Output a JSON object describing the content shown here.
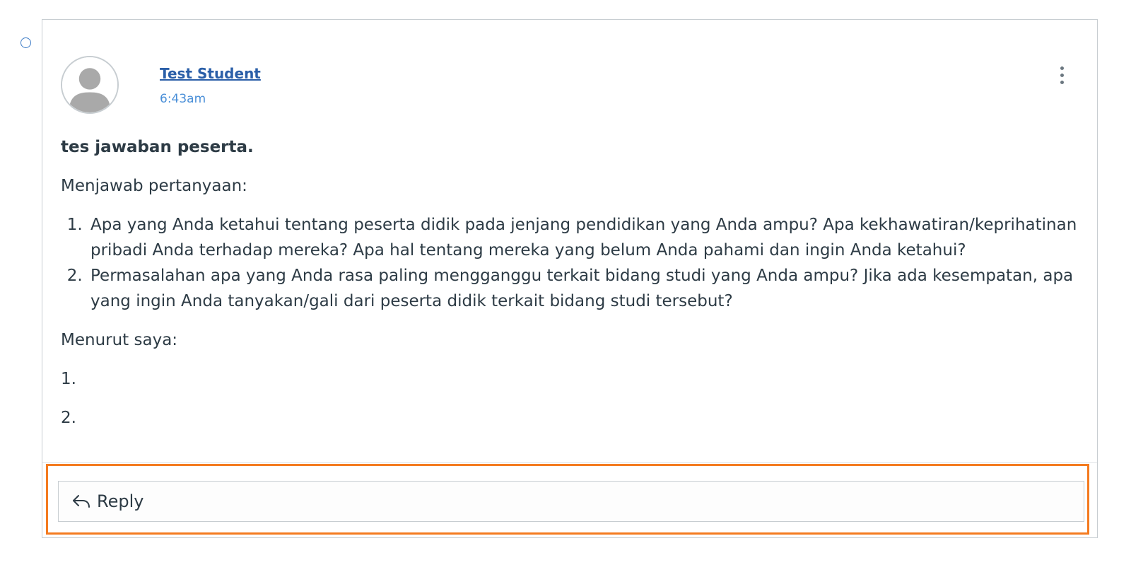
{
  "post": {
    "author": "Test Student",
    "timestamp": "6:43am",
    "title": "tes jawaban peserta.",
    "intro": "Menjawab pertanyaan:",
    "questions": [
      "Apa yang Anda ketahui tentang peserta didik pada jenjang pendidikan yang Anda ampu? Apa kekhawatiran/keprihatinan pribadi Anda terhadap mereka? Apa hal tentang mereka yang belum Anda pahami dan ingin Anda ketahui?",
      "Permasalahan apa yang Anda rasa paling mengganggu terkait bidang studi yang Anda ampu? Jika ada kesempatan, apa yang ingin Anda tanyakan/gali dari peserta didik terkait bidang studi tersebut?"
    ],
    "answer_intro": "Menurut saya:",
    "answers": [
      "1.",
      "2."
    ]
  },
  "actions": {
    "reply_label": "Reply"
  },
  "icons": {
    "unread": "unread-dot-icon",
    "menu": "kebab-menu-icon",
    "reply": "reply-arrow-icon",
    "avatar": "default-avatar-icon"
  },
  "colors": {
    "link": "#2b5fa8",
    "timestamp": "#4a8fd8",
    "focus_outline": "#f47b20",
    "border": "#c7cdd1"
  }
}
